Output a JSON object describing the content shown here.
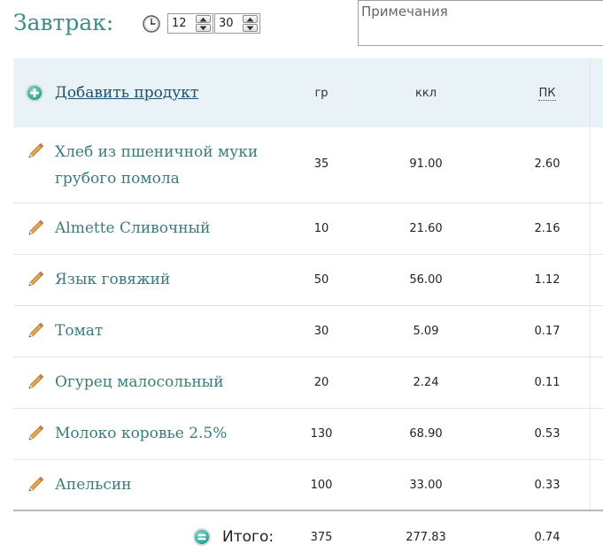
{
  "header": {
    "meal_title": "Завтрак:",
    "time_hours": "12",
    "time_minutes": "30",
    "notes_placeholder": "Примечания"
  },
  "table": {
    "add_product_label": "Добавить продукт",
    "columns": {
      "grams": "гр",
      "kcal": "ккл",
      "pk": "ПК"
    },
    "rows": [
      {
        "name": "Хлеб из пшеничной муки грубого помола",
        "grams": "35",
        "kcal": "91.00",
        "pk": "2.60"
      },
      {
        "name": "Almette Сливочный",
        "grams": "10",
        "kcal": "21.60",
        "pk": "2.16"
      },
      {
        "name": "Язык говяжий",
        "grams": "50",
        "kcal": "56.00",
        "pk": "1.12"
      },
      {
        "name": "Томат",
        "grams": "30",
        "kcal": "5.09",
        "pk": "0.17"
      },
      {
        "name": "Огурец малосольный",
        "grams": "20",
        "kcal": "2.24",
        "pk": "0.11"
      },
      {
        "name": "Молоко коровье 2.5%",
        "grams": "130",
        "kcal": "68.90",
        "pk": "0.53"
      },
      {
        "name": "Апельсин",
        "grams": "100",
        "kcal": "33.00",
        "pk": "0.33"
      }
    ],
    "totals": {
      "label": "Итого:",
      "grams": "375",
      "kcal": "277.83",
      "pk": "0.74"
    }
  },
  "icons": {
    "clock": "clock-icon",
    "add": "plus-circle-icon",
    "edit": "pencil-icon",
    "total": "equals-circle-icon"
  },
  "colors": {
    "accent_teal": "#3d8c8a",
    "link_blue": "#1d4f6e",
    "header_bg": "#e9f3f7"
  }
}
